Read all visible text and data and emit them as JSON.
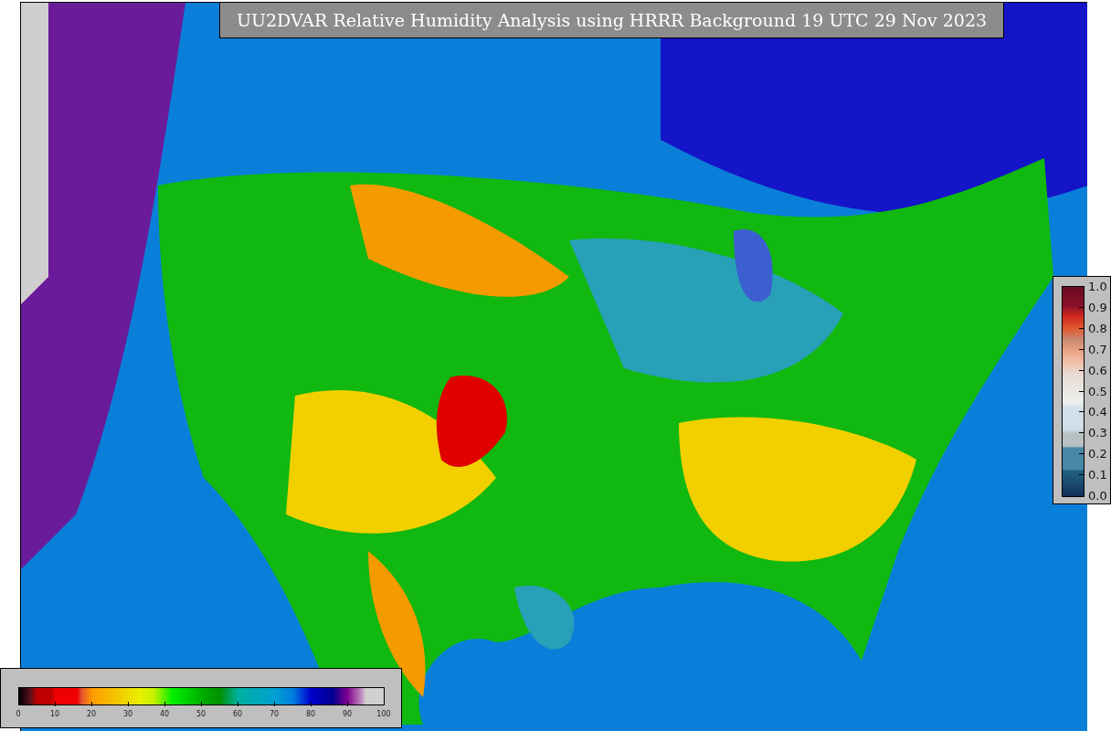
{
  "title": "UU2DVAR Relative Humidity Analysis using HRRR Background 19 UTC 29 Nov 2023",
  "humidity_colorbar": {
    "ticks": [
      "0",
      "10",
      "20",
      "30",
      "40",
      "50",
      "60",
      "70",
      "80",
      "90",
      "100"
    ]
  },
  "uncertainty_colorbar": {
    "ticks": [
      "1.0",
      "0.9",
      "0.8",
      "0.7",
      "0.6",
      "0.5",
      "0.4",
      "0.3",
      "0.2",
      "0.1",
      "0.0"
    ]
  }
}
